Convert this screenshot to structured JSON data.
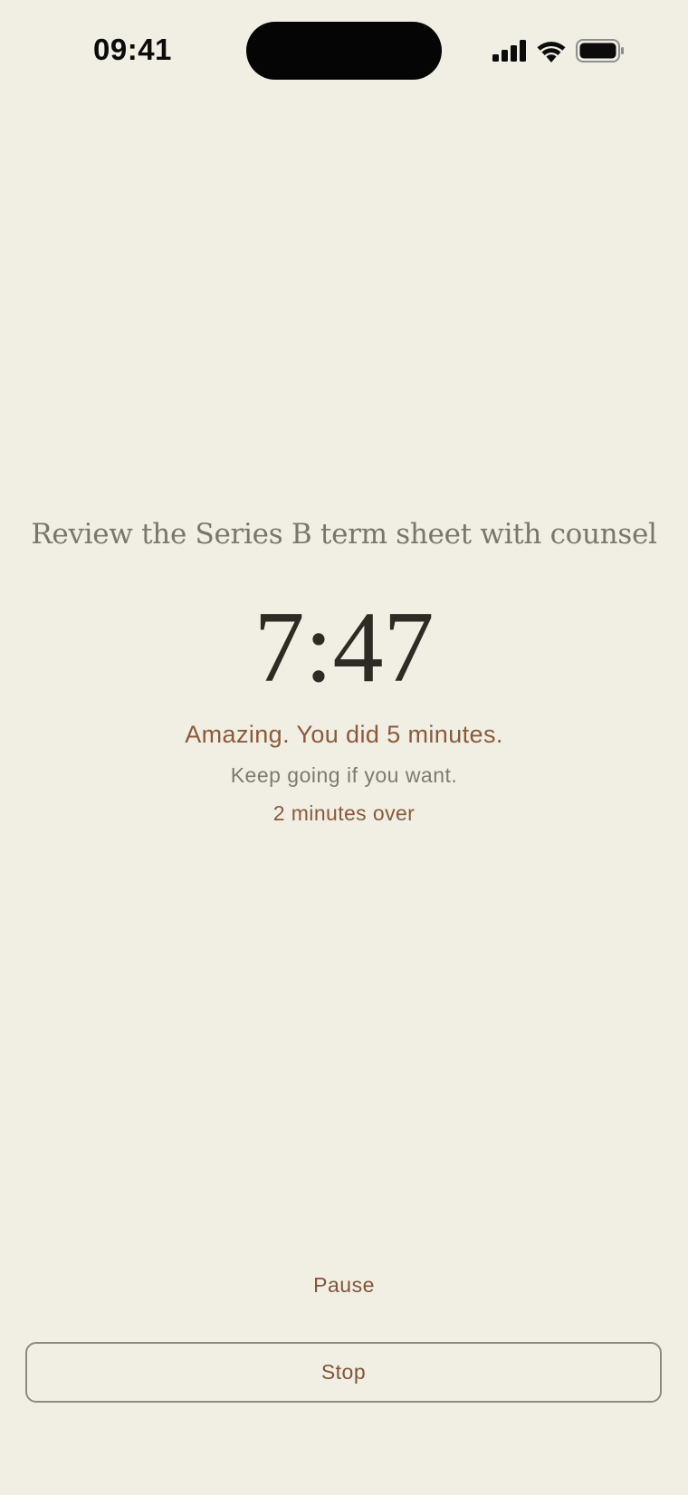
{
  "status_bar": {
    "time": "09:41",
    "icons": [
      "signal-icon",
      "wifi-icon",
      "battery-icon"
    ]
  },
  "session": {
    "task_title": "Review the Series B term sheet with counsel",
    "timer": "7:47",
    "encouragement": "Amazing. You did 5 minutes.",
    "subtext": "Keep going if you want.",
    "overtime": "2 minutes over"
  },
  "controls": {
    "pause_label": "Pause",
    "stop_label": "Stop"
  },
  "colors": {
    "background": "#f1eee4",
    "accent": "#8a5a3a",
    "timer_text": "#2d2b24",
    "muted_text": "#7a766d"
  }
}
